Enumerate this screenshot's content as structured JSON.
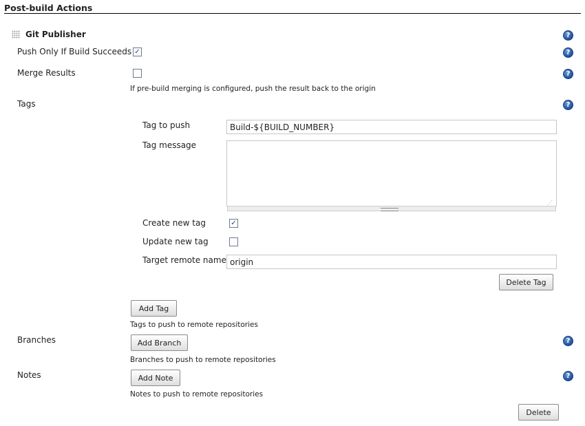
{
  "section": {
    "title": "Post-build Actions"
  },
  "publisher": {
    "title": "Git Publisher",
    "push_only_label": "Push Only If Build Succeeds",
    "push_only_checked": true,
    "merge_label": "Merge Results",
    "merge_checked": false,
    "merge_desc": "If pre-build merging is configured, push the result back to the origin",
    "delete_label": "Delete"
  },
  "tags": {
    "label": "Tags",
    "tag_to_push_label": "Tag to push",
    "tag_to_push_value": "Build-${BUILD_NUMBER}",
    "tag_message_label": "Tag message",
    "tag_message_value": "",
    "create_new_tag_label": "Create new tag",
    "create_new_tag_checked": true,
    "update_new_tag_label": "Update new tag",
    "update_new_tag_checked": false,
    "target_remote_label": "Target remote name",
    "target_remote_value": "origin",
    "delete_tag_label": "Delete Tag",
    "add_tag_label": "Add Tag",
    "desc": "Tags to push to remote repositories"
  },
  "branches": {
    "label": "Branches",
    "add_label": "Add Branch",
    "desc": "Branches to push to remote repositories"
  },
  "notes": {
    "label": "Notes",
    "add_label": "Add Note",
    "desc": "Notes to push to remote repositories"
  },
  "icons": {
    "help": "help-icon",
    "drag": "drag-handle-icon",
    "check": "✓"
  },
  "help_glyph": "?"
}
